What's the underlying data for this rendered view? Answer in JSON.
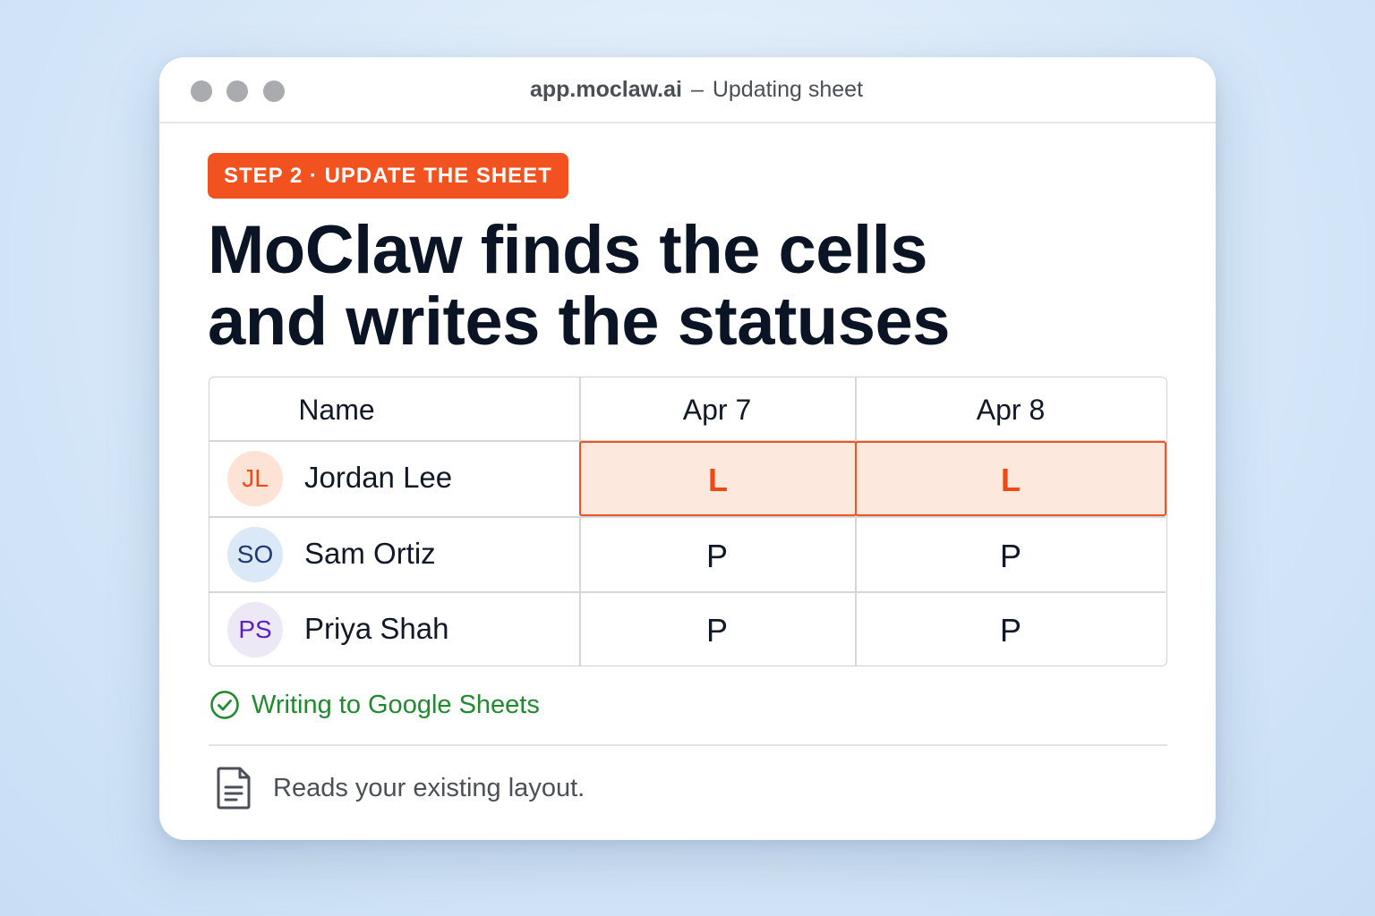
{
  "window": {
    "host": "app.moclaw.ai",
    "separator": "–",
    "subtitle": "Updating sheet"
  },
  "step_badge": "STEP 2 · UPDATE THE SHEET",
  "headline": {
    "line1": "MoClaw finds the cells",
    "line2": "and writes the statuses"
  },
  "sheet": {
    "headers": [
      "Name",
      "Apr 7",
      "Apr 8"
    ],
    "rows": [
      {
        "initials": "JL",
        "name": "Jordan Lee",
        "values": [
          "L",
          "L"
        ],
        "highlighted": true,
        "avatar_bg": "#fde3d6",
        "avatar_fg": "#ef4a16"
      },
      {
        "initials": "SO",
        "name": "Sam Ortiz",
        "values": [
          "P",
          "P"
        ],
        "highlighted": false,
        "avatar_bg": "#dbe8f8",
        "avatar_fg": "#1d3a73"
      },
      {
        "initials": "PS",
        "name": "Priya Shah",
        "values": [
          "P",
          "P"
        ],
        "highlighted": false,
        "avatar_bg": "#ece8f5",
        "avatar_fg": "#5b1fc7"
      }
    ]
  },
  "status": {
    "icon": "check-circle-icon",
    "text": "Writing to Google Sheets",
    "color": "#1f8a2e"
  },
  "note": {
    "icon": "document-icon",
    "text": "Reads your existing layout."
  },
  "colors": {
    "accent": "#f2521f",
    "highlight_bg": "#fde8dd",
    "headline": "#0b1424"
  }
}
